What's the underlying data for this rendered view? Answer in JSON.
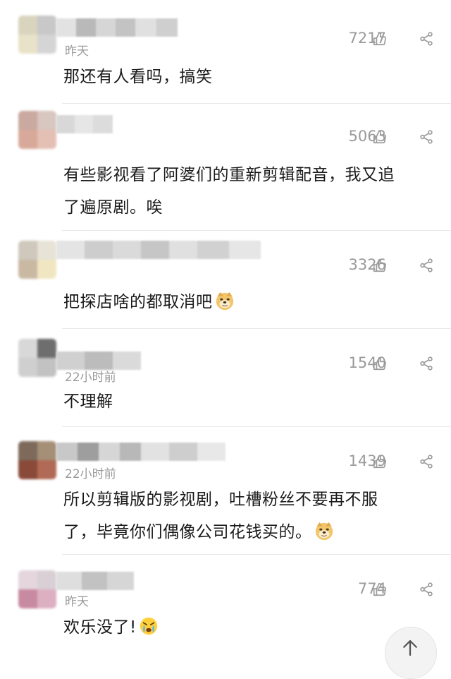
{
  "comments": [
    {
      "time": "昨天",
      "likes": "7217",
      "lines": [
        "那还有人看吗，搞笑"
      ]
    },
    {
      "time": "",
      "likes": "5063",
      "lines": [
        "有些影视看了阿婆们的重新剪辑配音，我又追",
        "了遍原剧。唉"
      ]
    },
    {
      "time": "",
      "likes": "3326",
      "lines": [
        "把探店啥的都取消吧"
      ]
    },
    {
      "time": "22小时前",
      "likes": "1540",
      "lines": [
        "不理解"
      ]
    },
    {
      "time": "22小时前",
      "likes": "1439",
      "lines": [
        "所以剪辑版的影视剧，吐槽粉丝不要再不服",
        "了，毕竟你们偶像公司花钱买的。"
      ]
    },
    {
      "time": "昨天",
      "likes": "774",
      "lines": [
        "欢乐没了!"
      ]
    }
  ],
  "icons": {
    "like": "thumbs-up-icon",
    "share": "share-icon",
    "doge": "doge-emoji-icon",
    "cry": "crying-emoji-icon",
    "scroll_top": "arrow-up-icon"
  },
  "colors": {
    "meta_gray": "#9a9a9a",
    "text": "#1a1a1a",
    "divider": "#e8e8e8"
  }
}
